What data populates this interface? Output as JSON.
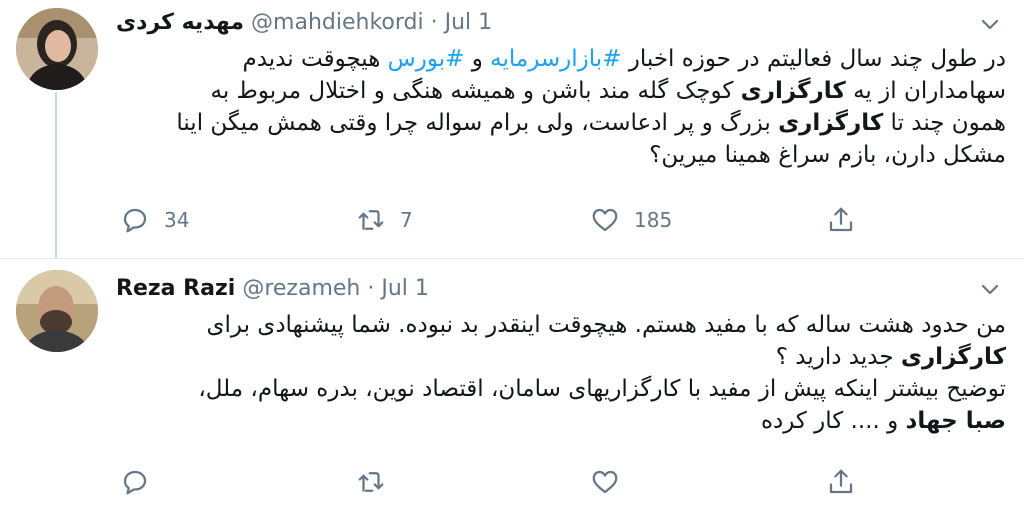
{
  "tweets": [
    {
      "display_name": "مهدیه کردی",
      "handle": "@mahdiehkordi",
      "separator": "·",
      "date": "Jul 1",
      "body_lines": [
        [
          {
            "text": "در طول چند سال فعالیتم در حوزه اخبار ",
            "style": "normal"
          },
          {
            "text": "#بازارسرمایه",
            "style": "hashtag"
          },
          {
            "text": " و ",
            "style": "normal"
          },
          {
            "text": "#بورس",
            "style": "hashtag"
          },
          {
            "text": " هیچوقت ندیدم",
            "style": "normal"
          }
        ],
        [
          {
            "text": "سهامداران از یه ",
            "style": "normal"
          },
          {
            "text": "کارگزاری",
            "style": "bold"
          },
          {
            "text": " کوچک گله مند باشن و همیشه هنگی و اختلال مربوط به",
            "style": "normal"
          }
        ],
        [
          {
            "text": "همون چند تا ",
            "style": "normal"
          },
          {
            "text": "کارگزاری",
            "style": "bold"
          },
          {
            "text": " بزرگ و پر ادعاست، ولی برام سواله چرا وقتی همش میگن اینا",
            "style": "normal"
          }
        ],
        [
          {
            "text": "مشکل دارن، بازم سراغ همینا میرین؟",
            "style": "normal"
          }
        ]
      ],
      "reply_count": "34",
      "retweet_count": "7",
      "like_count": "185"
    },
    {
      "display_name": "Reza Razi",
      "handle": "@rezameh",
      "separator": "·",
      "date": "Jul 1",
      "body_lines": [
        [
          {
            "text": "من حدود هشت ساله که با مفید هستم. هیچوقت اینقدر بد نبوده. شما پیشنهادی برای",
            "style": "normal"
          }
        ],
        [
          {
            "text": "کارگزاری",
            "style": "bold"
          },
          {
            "text": " جدید دارید ؟",
            "style": "normal"
          }
        ],
        [
          {
            "text": "توضیح بیشتر اینکه پیش از مفید با کارگزاریهای سامان، اقتصاد نوین، بدره سهام، ملل،",
            "style": "normal"
          }
        ],
        [
          {
            "text": "صبا جهاد",
            "style": "bold"
          },
          {
            "text": " و .... کار کرده",
            "style": "normal"
          }
        ]
      ],
      "reply_count": "",
      "retweet_count": "",
      "like_count": ""
    }
  ],
  "icons": {
    "caret": "chevron-down-icon",
    "reply": "reply-icon",
    "retweet": "retweet-icon",
    "like": "heart-icon",
    "share": "share-icon"
  },
  "colors": {
    "text": "#14171a",
    "secondary": "#657786",
    "link": "#1da1f2",
    "divider": "#e6ecf0",
    "thread_line": "#ccd6dd"
  }
}
